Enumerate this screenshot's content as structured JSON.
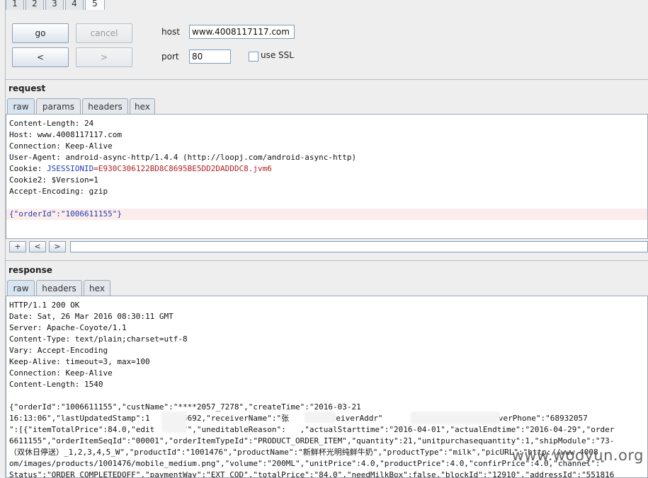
{
  "top_tabs": [
    {
      "label": "1",
      "selected": false
    },
    {
      "label": "2",
      "selected": false
    },
    {
      "label": "3",
      "selected": false
    },
    {
      "label": "4",
      "selected": false
    },
    {
      "label": "5",
      "selected": true
    }
  ],
  "controls": {
    "go_label": "go",
    "cancel_label": "cancel",
    "back_label": "<",
    "forward_label": ">",
    "host_label": "host",
    "host_value": "www.4008117117.com",
    "port_label": "port",
    "port_value": "80",
    "ssl_label": "use SSL",
    "ssl_checked": false
  },
  "request": {
    "title": "request",
    "tabs": [
      "raw",
      "params",
      "headers",
      "hex"
    ],
    "lines": [
      "Content-Length: 24",
      "Host: www.4008117117.com",
      "Connection: Keep-Alive",
      "User-Agent: android-async-http/1.4.4 (http://loopj.com/android-async-http)",
      "",
      "Cookie2: $Version=1",
      "Accept-Encoding: gzip",
      ""
    ],
    "cookie_prefix": "Cookie: ",
    "cookie_key": "JSESSIONID",
    "cookie_value": "=E930C306122BD8C8695BE5DD2DADDDC8.jvm6",
    "body_line": "{\"orderId\":\"1006611155\"}",
    "nav_buttons": [
      "+",
      "<",
      ">"
    ]
  },
  "response": {
    "title": "response",
    "tabs": [
      "raw",
      "headers",
      "hex"
    ],
    "lines": [
      "HTTP/1.1 200 OK",
      "Date: Sat, 26 Mar 2016 08:30:11 GMT",
      "Server: Apache-Coyote/1.1",
      "Content-Type: text/plain;charset=utf-8",
      "Vary: Accept-Encoding",
      "Keep-Alive: timeout=3, max=100",
      "Connection: Keep-Alive",
      "Content-Length: 1540",
      "",
      "{\"orderId\":\"1006611155\",\"custName\":\"****2057_7278\",\"createTime\":\"2016-03-21",
      "16:13:06\",\"lastUpdatedStamp\":1      86692,\"receiverName\":\"张    \",\"receiverAddr\"              2室\",\"receiverPhone\":\"68932057",
      "\":[{\"itemTotalPrice\":84.0,\"edit     \"Y\",\"uneditableReason\":   ,\"actualStarttime\":\"2016-04-01\",\"actualEndtime\":\"2016-04-29\",\"order",
      "6611155\",\"orderItemSeqId\":\"00001\",\"orderItemTypeId\":\"PRODUCT_ORDER_ITEM\",\"quantity\":21,\"unitpurchasequantity\":1,\"shipModule\":\"73-",
      "（双休日停送）_1,2,3,4,5_W\",\"productId\":\"1001476\",\"productName\":\"新鲜杯光明纯鲜牛奶\",\"productType\":\"milk\",\"picURL\":\"http://www.4008",
      "om/images/products/1001476/mobile_medium.png\",\"volume\":\"200ML\",\"unitPrice\":4.0,\"productPrice\":4.0,\"confirPrice\":4.0,\"channel\":\"",
      "Status\":\"ORDER_COMPLETEDOFF\",\"paymentWay\":\"EXT_COD\",\"totalPrice\":\"84.0\",\"needMilkBox\":false,\"blockId\":\"12910\",\"addressId\":\"551816"
    ]
  },
  "watermark": "www.wooyun.org"
}
